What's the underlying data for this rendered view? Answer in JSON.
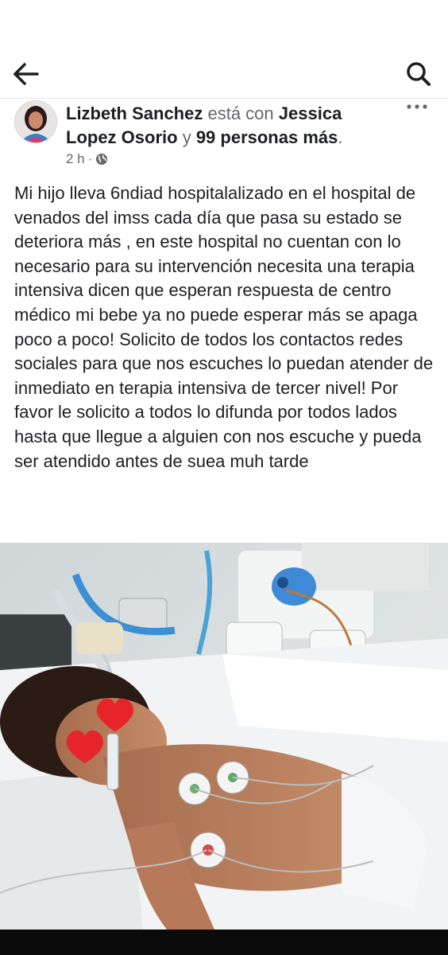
{
  "header": {
    "back_icon": "arrow-left-icon",
    "search_icon": "search-icon"
  },
  "post": {
    "author_name": "Lizbeth Sanchez",
    "with_text": "está con",
    "tagged_name": "Jessica Lopez Osorio",
    "and_text": "y",
    "others_text": "99 personas más",
    "period": ".",
    "time": "2 h",
    "separator": "·",
    "privacy_icon": "globe-icon",
    "more_icon": "more-dots-icon",
    "text": "Mi hijo lleva 6ndiad hospitalalizado en el hospital de venados del imss cada día que pasa su estado se deteriora más , en este hospital no cuentan con lo necesario para su intervención necesita una terapia intensiva dicen que esperan respuesta de centro médico mi bebe ya no puede esperar más se apaga poco a poco! Solicito de todos los contactos redes sociales para que nos escuches lo puedan atender de inmediato en terapia intensiva de tercer nivel! Por favor le solicito a todos lo difunda por todos lados hasta que llegue a alguien con nos escuche y pueda ser atendido antes de suea muh tarde"
  },
  "colors": {
    "text": "#1c1e21",
    "muted": "#65676b",
    "heart": "#e8242b"
  }
}
